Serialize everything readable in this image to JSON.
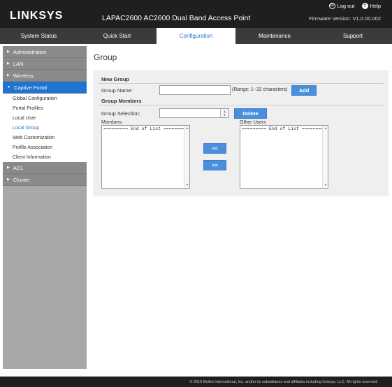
{
  "header": {
    "logo": "LINKSYS",
    "product": "LAPAC2600 AC2600 Dual Band Access Point",
    "firmware": "Firmware Version: V1.0.00.002",
    "logout": "Log out",
    "help": "Help"
  },
  "nav": {
    "tabs": [
      {
        "label": "System Status"
      },
      {
        "label": "Quick Start"
      },
      {
        "label": "Configuration"
      },
      {
        "label": "Maintenance"
      },
      {
        "label": "Support"
      }
    ],
    "active": "Configuration"
  },
  "sidebar": {
    "groups": [
      {
        "label": "Administration"
      },
      {
        "label": "LAN"
      },
      {
        "label": "Wireless"
      },
      {
        "label": "Captive Portal"
      },
      {
        "label": "ACL"
      },
      {
        "label": "Cluster"
      }
    ],
    "captive_items": [
      {
        "label": "Global Configuration"
      },
      {
        "label": "Portal Profiles"
      },
      {
        "label": "Local User"
      },
      {
        "label": "Local Group"
      },
      {
        "label": "Web Customization"
      },
      {
        "label": "Profile Association"
      },
      {
        "label": "Client Information"
      }
    ],
    "active_item": "Local Group"
  },
  "content": {
    "title": "Group",
    "new_group": {
      "heading": "New Group",
      "name_label": "Group Name:",
      "name_value": "",
      "range_hint": "(Range: 1~32 characters)",
      "add_label": "Add"
    },
    "members_section": {
      "heading": "Group Members",
      "selection_label": "Group Selection:",
      "selection_value": "",
      "delete_label": "Delete",
      "members_label": "Members",
      "members_list": [
        "========= End of List ========="
      ],
      "other_label": "Other Users",
      "other_list": [
        "========= End of List ========="
      ],
      "move_left": "<<",
      "move_right": ">>"
    }
  },
  "footer": {
    "copyright": "© 2016 Belkin International, Inc. and/or its subsidiaries and affiliates including Linksys, LLC. All rights reserved."
  },
  "colors": {
    "accent": "#1e74d2",
    "header_bg": "#1f1f1f",
    "nav_bg": "#3b3b3b",
    "sidebar_bg": "#a8a8a8",
    "button": "#4a8fdb"
  }
}
